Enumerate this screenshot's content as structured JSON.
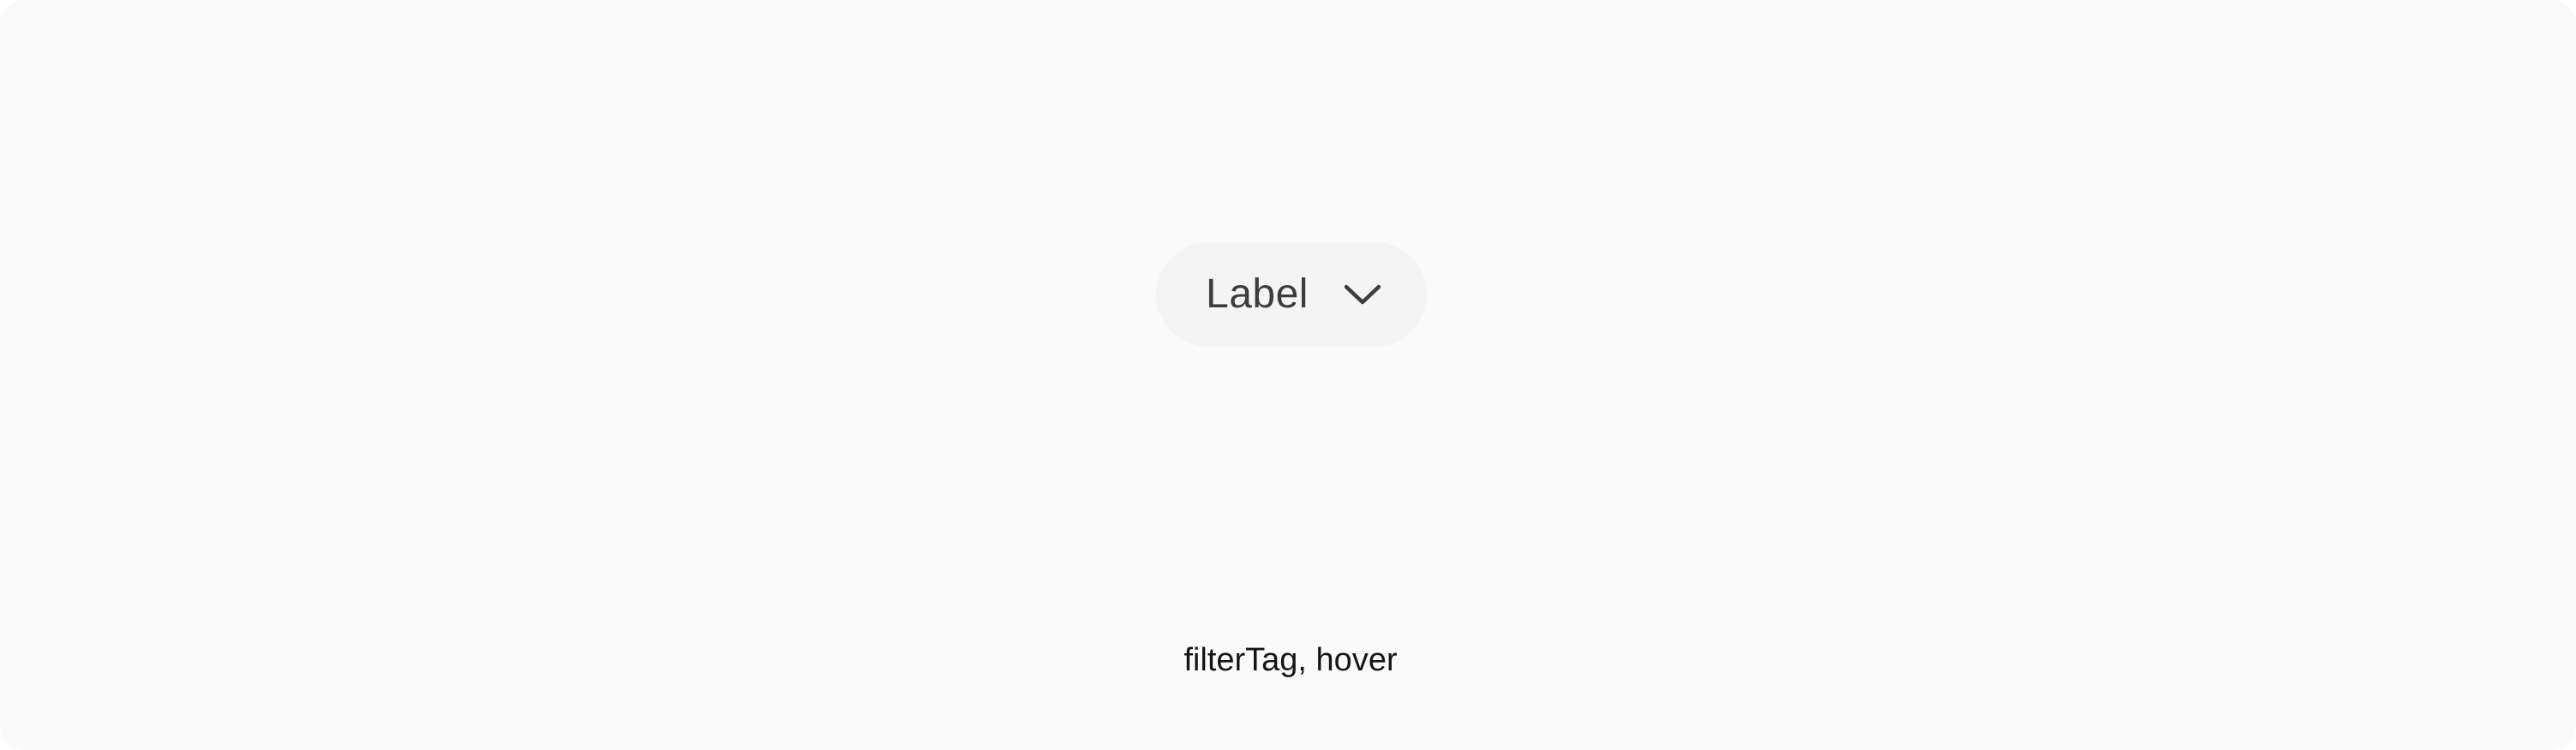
{
  "filter_tag": {
    "label": "Label",
    "icon": "chevron-down-icon",
    "state": "hover"
  },
  "caption": {
    "text": "filterTag, hover"
  },
  "colors": {
    "page_background": "#fafafa",
    "tag_background": "#f4f4f4",
    "tag_text": "#3d3d3d",
    "caption_text": "#161616"
  }
}
